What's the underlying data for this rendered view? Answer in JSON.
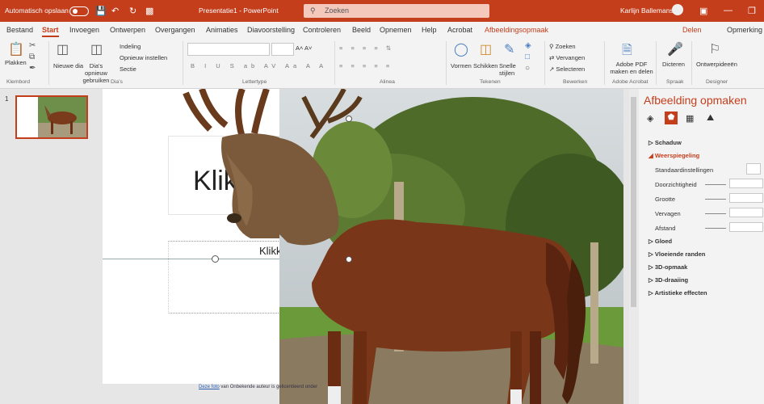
{
  "titlebar": {
    "autosave": "Automatisch opslaan",
    "doc_title": "Presentatie1 - PowerPoint",
    "search": "Zoeken",
    "user": "Karlijn Ballemans"
  },
  "tabs": [
    "Bestand",
    "Start",
    "Invoegen",
    "Ontwerpen",
    "Overgangen",
    "Animaties",
    "Diavoorstelling",
    "Controleren",
    "Beeld",
    "Opnemen",
    "Help",
    "Acrobat",
    "Afbeeldingsopmaak"
  ],
  "tab_right": {
    "share": "Delen",
    "comments": "Opmerking"
  },
  "ribbon": {
    "clipboard": {
      "paste": "Plakken",
      "label": "Klembord"
    },
    "slides": {
      "new_slide": "Nieuwe dia",
      "reuse": "Dia's opnieuw gebruiken",
      "layout": "Indeling",
      "reset": "Opnieuw instellen",
      "section": "Sectie",
      "label": "Dia's"
    },
    "font_label": "Lettertype",
    "paragraph_label": "Alinea",
    "drawing": {
      "shapes": "Vormen",
      "arrange": "Schikken",
      "quick_styles": "Snelle stijlen",
      "label": "Tekenen"
    },
    "editing": {
      "find": "Zoeken",
      "replace": "Vervangen",
      "select": "Selecteren",
      "label": "Bewerken"
    },
    "acrobat": {
      "pdf": "Adobe PDF maken en delen",
      "label": "Adobe Acrobat"
    },
    "voice": {
      "dictate": "Dicteren",
      "label": "Spraak"
    },
    "designer": {
      "ideas": "Ontwerpideeën",
      "label": "Designer"
    }
  },
  "thumbnail_number": "1",
  "slide": {
    "title_text": "Klik",
    "subtitle_text": "Klikk",
    "credit_prefix": "Deze foto",
    "credit_text": "van Onbekende auteur is gelicentieerd onder"
  },
  "format_pane": {
    "title": "Afbeelding opmaken",
    "sections": {
      "shadow": "Schaduw",
      "reflection": "Weerspiegeling",
      "glow": "Gloed",
      "soft_edges": "Vloeiende randen",
      "3d_format": "3D-opmaak",
      "3d_rotation": "3D-draaiing",
      "artistic": "Artistieke effecten"
    },
    "presets": "Standaardinstellingen",
    "transparency": "Doorzichtigheid",
    "size": "Grootte",
    "blur": "Vervagen",
    "distance": "Afstand"
  },
  "colors": {
    "accent": "#c43e1c"
  }
}
